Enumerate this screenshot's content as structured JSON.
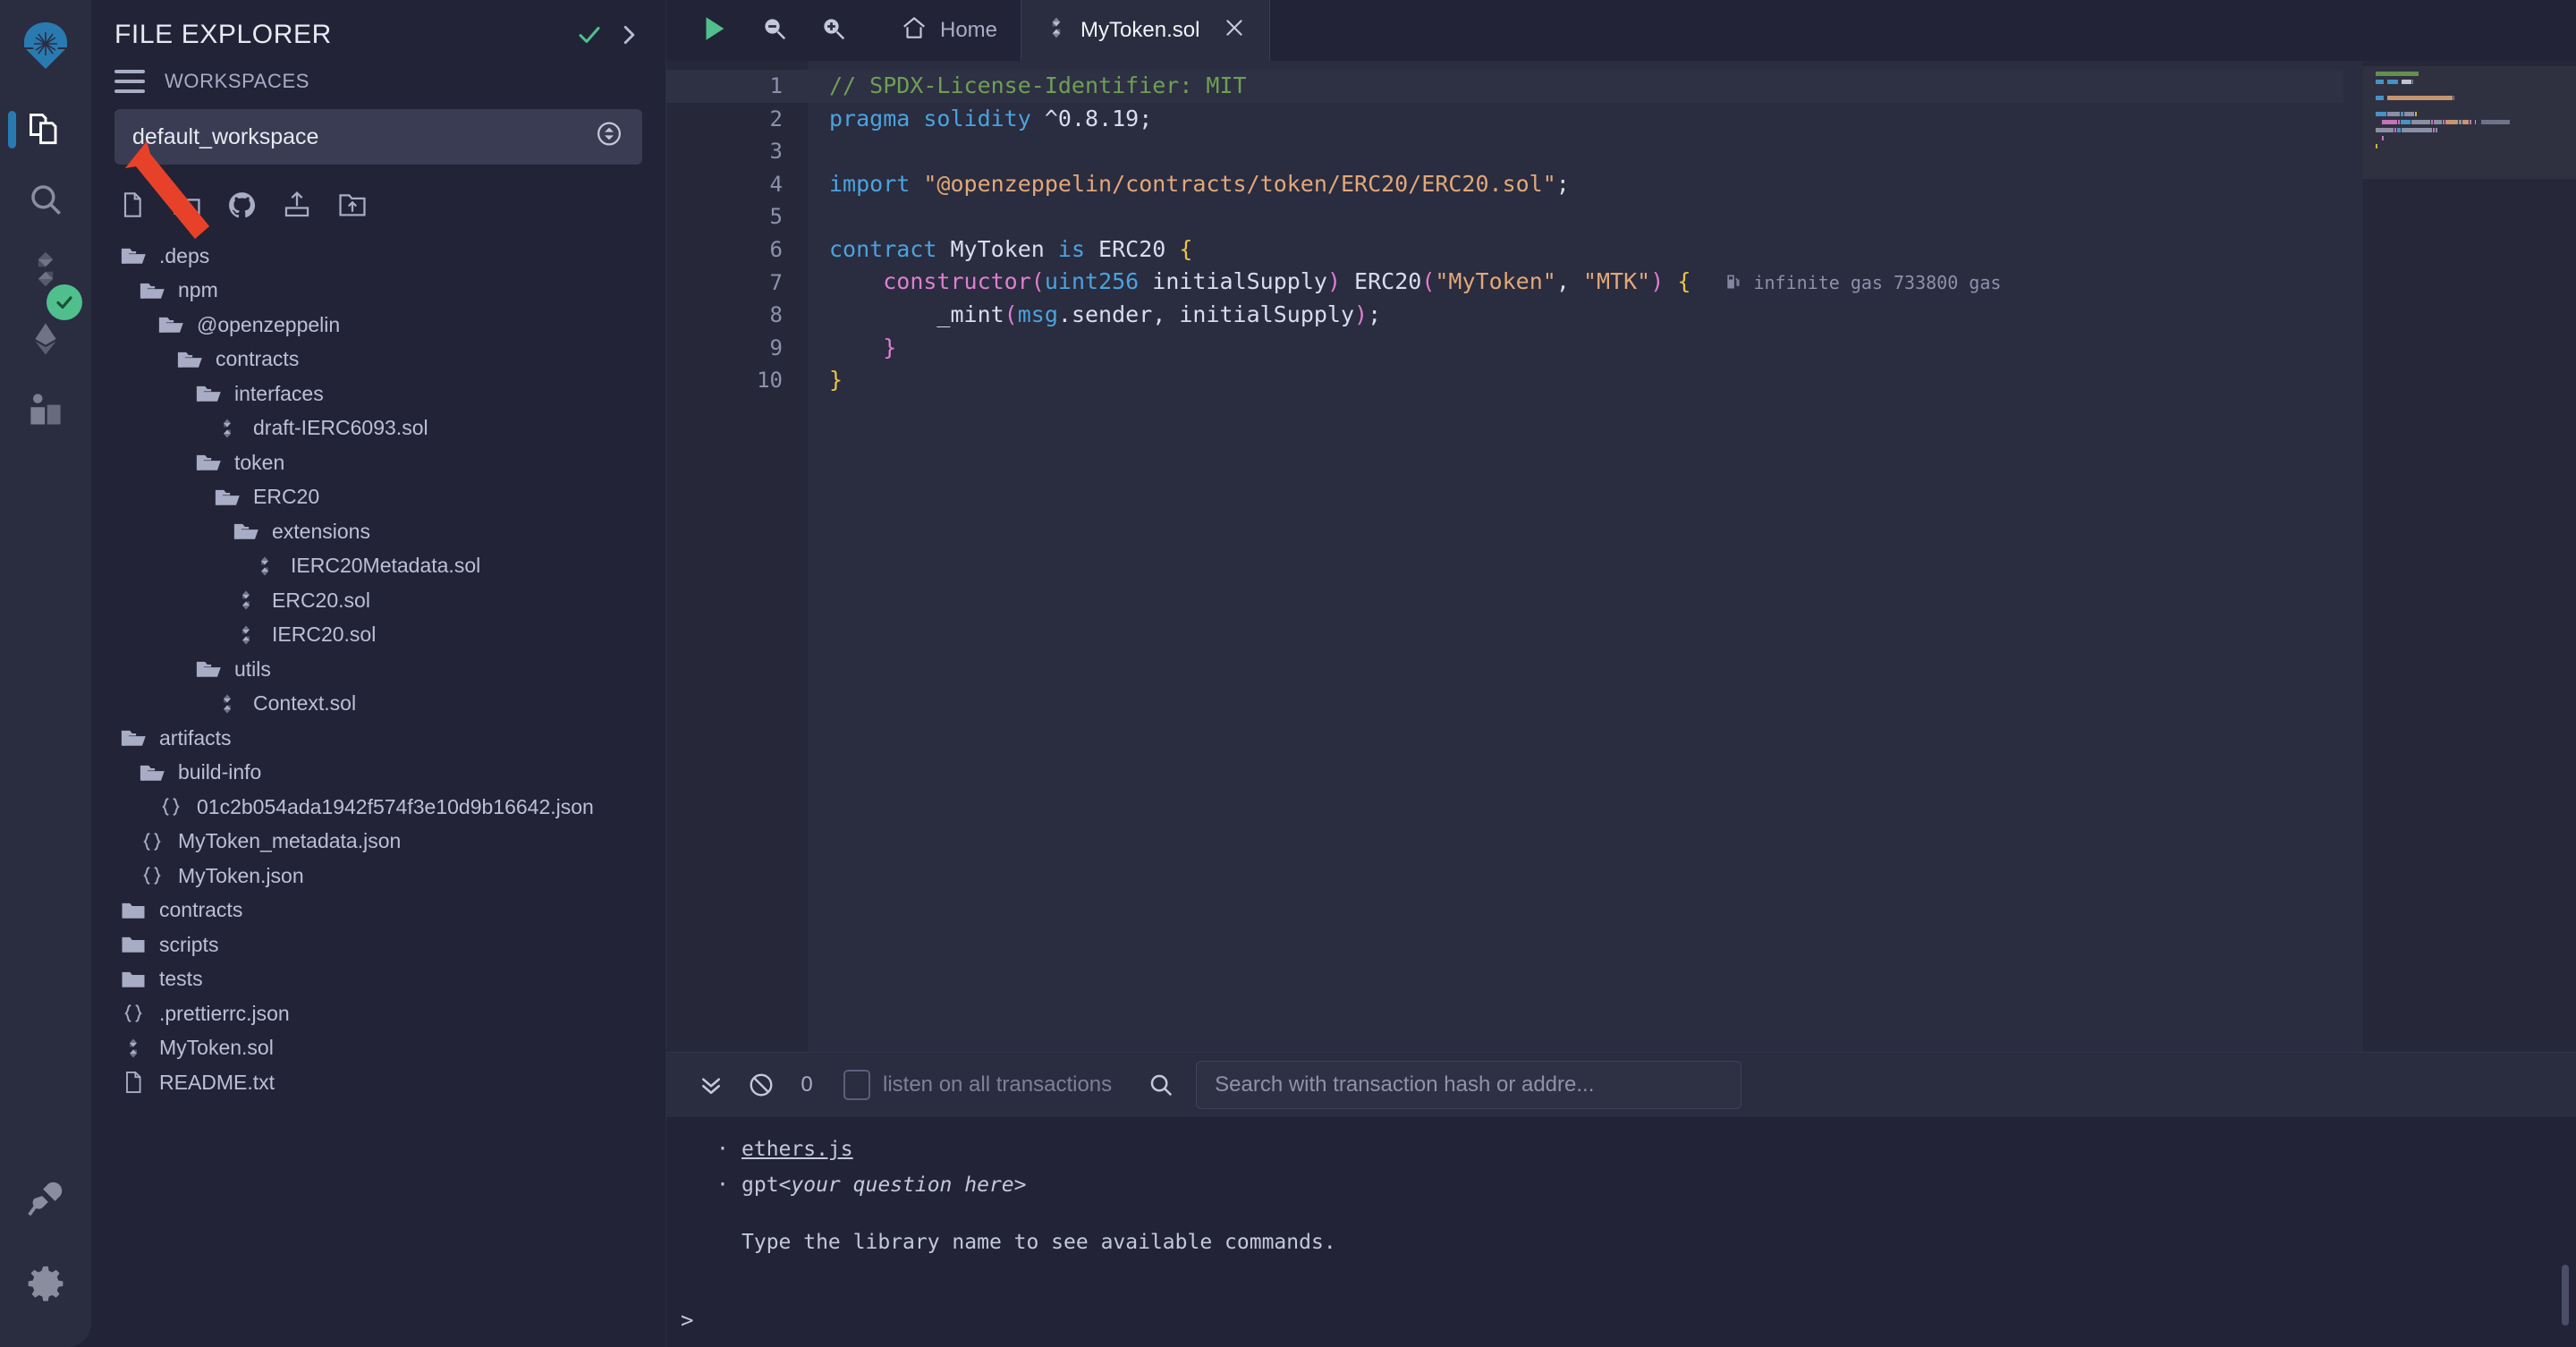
{
  "rail": {
    "logo_icon": "remix-logo-icon",
    "items": [
      {
        "name": "file-explorer",
        "icon": "files-icon",
        "active": true
      },
      {
        "name": "search",
        "icon": "search-icon",
        "active": false
      },
      {
        "name": "solidity-compiler",
        "icon": "solidity-icon",
        "active": false
      },
      {
        "name": "deploy-and-run",
        "icon": "ethereum-diamond-icon",
        "active": false
      },
      {
        "name": "learneth",
        "icon": "book-reader-icon",
        "active": false
      }
    ],
    "bottom_items": [
      {
        "name": "plugin-manager",
        "icon": "plug-icon"
      },
      {
        "name": "settings",
        "icon": "gear-icon"
      }
    ],
    "status_icon": "compile-success-check-icon",
    "status_color": "#4fc08d"
  },
  "explorer": {
    "title": "FILE EXPLORER",
    "header_icons": [
      "check-icon",
      "chevron-right-icon"
    ],
    "workspaces_label": "WORKSPACES",
    "workspace_selected": "default_workspace",
    "tools": [
      "new-file-icon",
      "new-folder-icon",
      "github-icon",
      "publish-to-gist-icon",
      "upload-folder-icon"
    ],
    "tree": [
      {
        "name": ".deps",
        "type": "folder-open",
        "depth": 0
      },
      {
        "name": "npm",
        "type": "folder-open",
        "depth": 1
      },
      {
        "name": "@openzeppelin",
        "type": "folder-open",
        "depth": 2
      },
      {
        "name": "contracts",
        "type": "folder-open",
        "depth": 3
      },
      {
        "name": "interfaces",
        "type": "folder-open",
        "depth": 4
      },
      {
        "name": "draft-IERC6093.sol",
        "type": "solidity",
        "depth": 5
      },
      {
        "name": "token",
        "type": "folder-open",
        "depth": 4
      },
      {
        "name": "ERC20",
        "type": "folder-open",
        "depth": 5
      },
      {
        "name": "extensions",
        "type": "folder-open",
        "depth": 6
      },
      {
        "name": "IERC20Metadata.sol",
        "type": "solidity",
        "depth": 7
      },
      {
        "name": "ERC20.sol",
        "type": "solidity",
        "depth": 6
      },
      {
        "name": "IERC20.sol",
        "type": "solidity",
        "depth": 6
      },
      {
        "name": "utils",
        "type": "folder-open",
        "depth": 4
      },
      {
        "name": "Context.sol",
        "type": "solidity",
        "depth": 5
      },
      {
        "name": "artifacts",
        "type": "folder-open",
        "depth": 0
      },
      {
        "name": "build-info",
        "type": "folder-open",
        "depth": 1
      },
      {
        "name": "01c2b054ada1942f574f3e10d9b16642.json",
        "type": "json",
        "depth": 2
      },
      {
        "name": "MyToken_metadata.json",
        "type": "json",
        "depth": 1
      },
      {
        "name": "MyToken.json",
        "type": "json",
        "depth": 1
      },
      {
        "name": "contracts",
        "type": "folder",
        "depth": 0
      },
      {
        "name": "scripts",
        "type": "folder",
        "depth": 0
      },
      {
        "name": "tests",
        "type": "folder",
        "depth": 0
      },
      {
        "name": ".prettierrc.json",
        "type": "json",
        "depth": 0
      },
      {
        "name": "MyToken.sol",
        "type": "solidity",
        "depth": 0
      },
      {
        "name": "README.txt",
        "type": "text",
        "depth": 0
      }
    ]
  },
  "tabbar": {
    "run_icon": "play-icon",
    "zoom_out_icon": "zoom-out-icon",
    "zoom_in_icon": "zoom-in-icon",
    "tabs": [
      {
        "label": "Home",
        "icon": "home-icon",
        "active": false,
        "closable": false
      },
      {
        "label": "MyToken.sol",
        "icon": "solidity-icon",
        "active": true,
        "closable": true
      }
    ],
    "close_label": "✕"
  },
  "editor": {
    "active_line": 1,
    "gas_annotation": "infinite gas 733800 gas",
    "gas_icon": "gas-pump-icon",
    "lines": [
      {
        "no": "1",
        "tokens": [
          {
            "t": "// SPDX-License-Identifier: MIT",
            "c": "c-com"
          }
        ]
      },
      {
        "no": "2",
        "tokens": [
          {
            "t": "pragma",
            "c": "c-kw"
          },
          {
            "t": " ",
            "c": "c-pln"
          },
          {
            "t": "solidity",
            "c": "c-kw"
          },
          {
            "t": " ",
            "c": "c-pln"
          },
          {
            "t": "^0.8.19",
            "c": "c-num"
          },
          {
            "t": ";",
            "c": "c-pln"
          }
        ]
      },
      {
        "no": "3",
        "tokens": []
      },
      {
        "no": "4",
        "tokens": [
          {
            "t": "import",
            "c": "c-kw"
          },
          {
            "t": " ",
            "c": "c-pln"
          },
          {
            "t": "\"@openzeppelin/contracts/token/ERC20/ERC20.sol\"",
            "c": "c-str"
          },
          {
            "t": ";",
            "c": "c-pln"
          }
        ]
      },
      {
        "no": "5",
        "tokens": []
      },
      {
        "no": "6",
        "tokens": [
          {
            "t": "contract",
            "c": "c-kw"
          },
          {
            "t": " MyToken ",
            "c": "c-pln"
          },
          {
            "t": "is",
            "c": "c-kw"
          },
          {
            "t": " ERC20 ",
            "c": "c-pln"
          },
          {
            "t": "{",
            "c": "c-brc"
          }
        ]
      },
      {
        "no": "7",
        "tokens": [
          {
            "t": "    ",
            "c": "c-pln"
          },
          {
            "t": "constructor",
            "c": "c-pnk"
          },
          {
            "t": "(",
            "c": "c-pnk"
          },
          {
            "t": "uint256",
            "c": "c-typ"
          },
          {
            "t": " initialSupply",
            "c": "c-pln"
          },
          {
            "t": ")",
            "c": "c-pnk"
          },
          {
            "t": " ERC20",
            "c": "c-pln"
          },
          {
            "t": "(",
            "c": "c-pnk"
          },
          {
            "t": "\"MyToken\"",
            "c": "c-str"
          },
          {
            "t": ", ",
            "c": "c-pln"
          },
          {
            "t": "\"MTK\"",
            "c": "c-str"
          },
          {
            "t": ")",
            "c": "c-pnk"
          },
          {
            "t": " ",
            "c": "c-pln"
          },
          {
            "t": "{",
            "c": "c-brc"
          }
        ]
      },
      {
        "no": "8",
        "tokens": [
          {
            "t": "        _mint",
            "c": "c-pln"
          },
          {
            "t": "(",
            "c": "c-pnk"
          },
          {
            "t": "msg",
            "c": "c-kw"
          },
          {
            "t": ".sender, initialSupply",
            "c": "c-pln"
          },
          {
            "t": ")",
            "c": "c-pnk"
          },
          {
            "t": ";",
            "c": "c-pln"
          }
        ]
      },
      {
        "no": "9",
        "tokens": [
          {
            "t": "    ",
            "c": "c-pln"
          },
          {
            "t": "}",
            "c": "c-pnk"
          }
        ]
      },
      {
        "no": "10",
        "tokens": [
          {
            "t": "}",
            "c": "c-brc"
          }
        ]
      }
    ]
  },
  "terminal": {
    "collapse_icon": "double-chevron-down-icon",
    "clear_icon": "ban-icon",
    "count": "0",
    "listen_checkbox_label": "listen on all transactions",
    "listen_checked": false,
    "search_icon": "search-icon",
    "search_placeholder": "Search with transaction hash or addre...",
    "lines": [
      {
        "bullet": "·",
        "text": "ethers.js",
        "link": true
      },
      {
        "bullet": "·",
        "text": "gpt ",
        "italic_suffix": "<your question here>"
      }
    ],
    "note": "Type the library name to see available commands.",
    "prompt": ">"
  },
  "annotation": {
    "arrow_color": "#e8412a",
    "arrow_target": "compile-status-check-icon"
  }
}
